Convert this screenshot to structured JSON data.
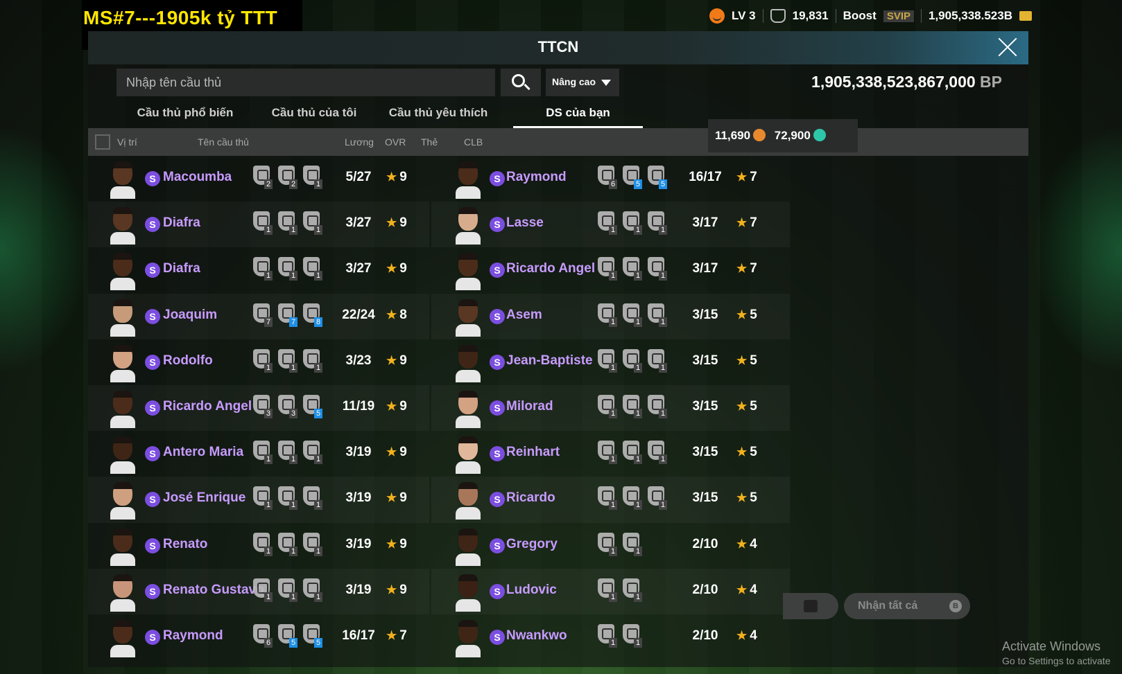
{
  "overlay_text": "MS#7---1905k tỷ TTT",
  "topbar": {
    "level": "LV 3",
    "trophies": "19,831",
    "boost": "Boost",
    "svip": "SVIP",
    "balance": "1,905,338.523B"
  },
  "panel": {
    "title": "TTCN",
    "search_placeholder": "Nhập tên cầu thủ",
    "advanced": "Nâng cao",
    "bp_value": "1,905,338,523,867,000",
    "bp_unit": "BP"
  },
  "tabs": [
    "Cầu thủ phổ biến",
    "Cầu thủ của tôi",
    "Cầu thủ yêu thích",
    "DS của bạn"
  ],
  "columns": {
    "position": "Vị trí",
    "name": "Tên cầu thủ",
    "salary": "Lương",
    "ovr": "OVR",
    "card": "Thẻ",
    "club": "CLB"
  },
  "coins": {
    "sc": "11,690",
    "tc": "72,900"
  },
  "badge_letter": "S",
  "left_players": [
    {
      "name": "Macoumba",
      "salary": "5/27",
      "ovr": "9",
      "clubs": [
        "2",
        "2",
        "1"
      ],
      "skin": "#5a3722"
    },
    {
      "name": "Diafra",
      "salary": "3/27",
      "ovr": "9",
      "clubs": [
        "1",
        "1",
        "1"
      ],
      "skin": "#5a3722"
    },
    {
      "name": "Diafra",
      "salary": "3/27",
      "ovr": "9",
      "clubs": [
        "1",
        "1",
        "1"
      ],
      "skin": "#4b2c1a"
    },
    {
      "name": "Joaquim",
      "salary": "22/24",
      "ovr": "8",
      "clubs": [
        "7",
        "7",
        "8"
      ],
      "skin": "#c79b79"
    },
    {
      "name": "Rodolfo",
      "salary": "3/23",
      "ovr": "9",
      "clubs": [
        "1",
        "1",
        "1"
      ],
      "skin": "#d2a283"
    },
    {
      "name": "Ricardo Angel",
      "salary": "11/19",
      "ovr": "9",
      "clubs": [
        "3",
        "3",
        "5"
      ],
      "skin": "#4b2c1a"
    },
    {
      "name": "Antero Maria",
      "salary": "3/19",
      "ovr": "9",
      "clubs": [
        "1",
        "1",
        "1"
      ],
      "skin": "#3f2516"
    },
    {
      "name": "José Enrique",
      "salary": "3/19",
      "ovr": "9",
      "clubs": [
        "1",
        "1",
        "1"
      ],
      "skin": "#cfa080"
    },
    {
      "name": "Renato",
      "salary": "3/19",
      "ovr": "9",
      "clubs": [
        "1",
        "1",
        "1"
      ],
      "skin": "#4b2c1a"
    },
    {
      "name": "Renato Gustavo",
      "salary": "3/19",
      "ovr": "9",
      "clubs": [
        "1",
        "1",
        "1"
      ],
      "skin": "#c9957a"
    },
    {
      "name": "Raymond",
      "salary": "16/17",
      "ovr": "7",
      "clubs": [
        "6",
        "5",
        "5"
      ],
      "skin": "#4b2c1a"
    }
  ],
  "right_players": [
    {
      "name": "Raymond",
      "salary": "16/17",
      "ovr": "7",
      "clubs": [
        "6",
        "5",
        "5"
      ],
      "skin": "#4b2c1a"
    },
    {
      "name": "Lasse",
      "salary": "3/17",
      "ovr": "7",
      "clubs": [
        "1",
        "1",
        "1"
      ],
      "skin": "#d7ac8d"
    },
    {
      "name": "Ricardo Angel",
      "salary": "3/17",
      "ovr": "7",
      "clubs": [
        "1",
        "1",
        "1"
      ],
      "skin": "#4b2c1a"
    },
    {
      "name": "Asem",
      "salary": "3/15",
      "ovr": "5",
      "clubs": [
        "1",
        "1",
        "1"
      ],
      "skin": "#5a3722"
    },
    {
      "name": "Jean-Baptiste",
      "salary": "3/15",
      "ovr": "5",
      "clubs": [
        "1",
        "1",
        "1"
      ],
      "skin": "#3f2516"
    },
    {
      "name": "Milorad",
      "salary": "3/15",
      "ovr": "5",
      "clubs": [
        "1",
        "1",
        "1"
      ],
      "skin": "#d2a283"
    },
    {
      "name": "Reinhart",
      "salary": "3/15",
      "ovr": "5",
      "clubs": [
        "1",
        "1",
        "1"
      ],
      "skin": "#e0b79a"
    },
    {
      "name": "Ricardo",
      "salary": "3/15",
      "ovr": "5",
      "clubs": [
        "1",
        "1",
        "1"
      ],
      "skin": "#a8775a"
    },
    {
      "name": "Gregory",
      "salary": "2/10",
      "ovr": "4",
      "clubs": [
        "1",
        "1"
      ],
      "skin": "#3f2516"
    },
    {
      "name": "Ludovic",
      "salary": "2/10",
      "ovr": "4",
      "clubs": [
        "1",
        "1"
      ],
      "skin": "#3a2114"
    },
    {
      "name": "Nwankwo",
      "salary": "2/10",
      "ovr": "4",
      "clubs": [
        "1",
        "1"
      ],
      "skin": "#3f2516"
    }
  ],
  "claim_all": "Nhận tất cả",
  "claim_key": "B",
  "watermark": {
    "line1": "Activate Windows",
    "line2": "Go to Settings to activate"
  }
}
